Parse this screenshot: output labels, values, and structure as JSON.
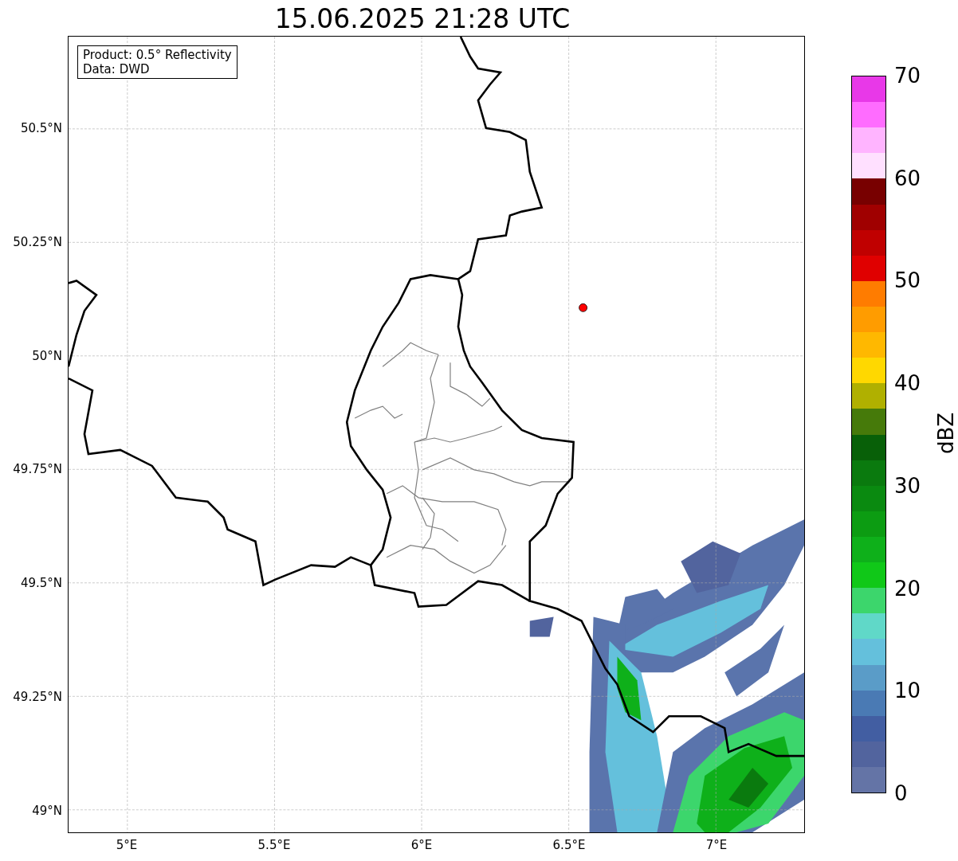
{
  "title": "15.06.2025 21:28 UTC",
  "legend": [
    "Product: 0.5° Reflectivity",
    "Data: DWD"
  ],
  "lat_ticks": [
    "50.5°N",
    "50.25°N",
    "50°N",
    "49.75°N",
    "49.5°N",
    "49.25°N",
    "49°N"
  ],
  "lon_ticks": [
    "5°E",
    "5.5°E",
    "6°E",
    "6.5°E",
    "7°E"
  ],
  "colorbar": {
    "label": "dBZ",
    "ticks": [
      "70",
      "60",
      "50",
      "40",
      "30",
      "20",
      "10",
      "0"
    ],
    "bands": [
      {
        "color": "#e838e8"
      },
      {
        "color": "#ff6cff"
      },
      {
        "color": "#ffb4ff"
      },
      {
        "color": "#ffe0ff"
      },
      {
        "color": "#780000"
      },
      {
        "color": "#a00000"
      },
      {
        "color": "#c00000"
      },
      {
        "color": "#e00000"
      },
      {
        "color": "#ff7c00"
      },
      {
        "color": "#ff9c00"
      },
      {
        "color": "#ffb800"
      },
      {
        "color": "#ffd800"
      },
      {
        "color": "#b0b000"
      },
      {
        "color": "#467a0a"
      },
      {
        "color": "#086008"
      },
      {
        "color": "#0a7a0e"
      },
      {
        "color": "#0a8a10"
      },
      {
        "color": "#0c9c12"
      },
      {
        "color": "#0eb01a"
      },
      {
        "color": "#10c818"
      },
      {
        "color": "#3cd66c"
      },
      {
        "color": "#60d8c8"
      },
      {
        "color": "#64c0dc"
      },
      {
        "color": "#5a9cc8"
      },
      {
        "color": "#4a7ab4"
      },
      {
        "color": "#425ea2"
      },
      {
        "color": "#52649e"
      },
      {
        "color": "#6474a6"
      }
    ]
  }
}
